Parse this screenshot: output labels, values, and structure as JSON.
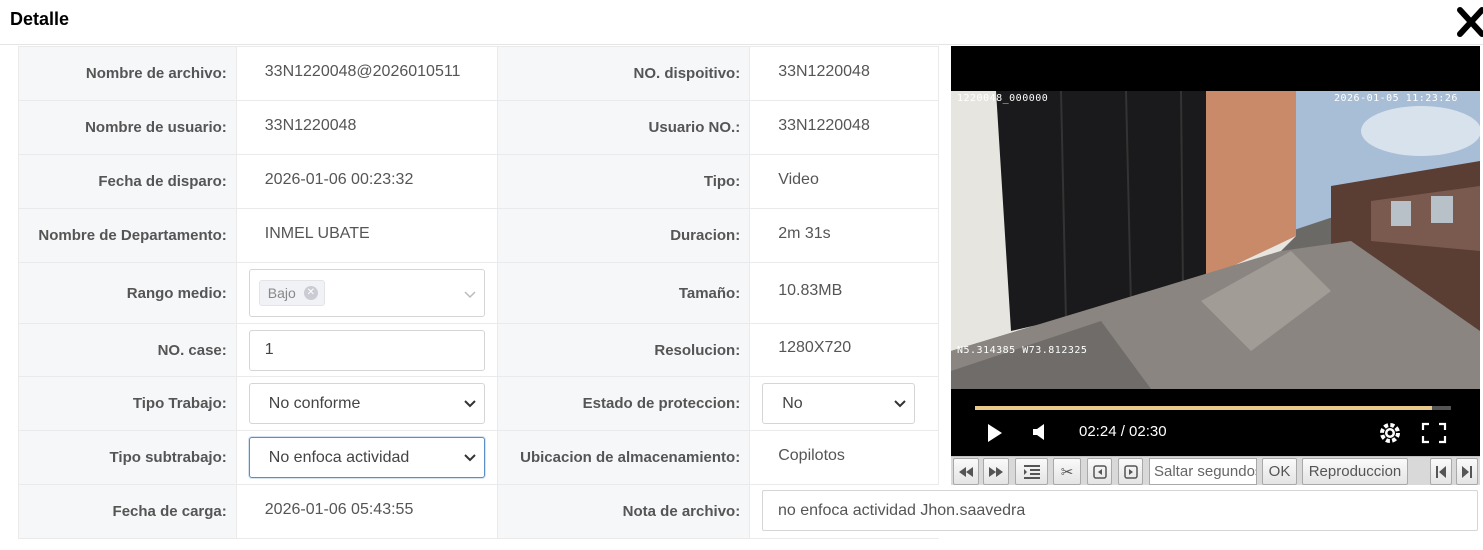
{
  "dialog": {
    "title": "Detalle",
    "close_icon": "close-icon"
  },
  "fields": {
    "filename_label": "Nombre de archivo:",
    "filename_value": "33N1220048@2026010511",
    "device_label": "NO. dispoitivo:",
    "device_value": "33N1220048",
    "user_label": "Nombre de usuario:",
    "user_value": "33N1220048",
    "userno_label": "Usuario NO.:",
    "userno_value": "33N1220048",
    "trigger_label": "Fecha de disparo:",
    "trigger_value": "2026-01-06 00:23:32",
    "type_label": "Tipo:",
    "type_value": "Video",
    "dept_label": "Nombre de Departamento:",
    "dept_value": "INMEL UBATE",
    "duration_label": "Duracion:",
    "duration_value": "2m 31s",
    "range_label": "Rango medio:",
    "range_tag": "Bajo",
    "size_label": "Tamaño:",
    "size_value": "10.83MB",
    "case_label": "NO. case:",
    "case_value": "1",
    "resolution_label": "Resolucion:",
    "resolution_value": "1280X720",
    "worktype_label": "Tipo Trabajo:",
    "worktype_value": "No conforme",
    "protection_label": "Estado de proteccion:",
    "protection_value": "No",
    "subwork_label": "Tipo subtrabajo:",
    "subwork_value": "No enfoca actividad",
    "storage_label": "Ubicacion de almacenamiento:",
    "storage_value": "Copilotos",
    "upload_label": "Fecha de carga:",
    "upload_value": "2026-01-06 05:43:55",
    "note_label": "Nota de archivo:",
    "note_value": "no enfoca actividad Jhon.saavedra"
  },
  "player": {
    "osd_id": "1220048_000000",
    "osd_datetime": "2026-01-05 11:23:26",
    "osd_gps": "N5.314385 W73.812325",
    "time_display": "02:24 / 02:30",
    "progress_fraction": 0.96,
    "colors": {
      "progress": "#e8c98a",
      "background": "#000000"
    }
  },
  "toolbar": {
    "seek_placeholder": "Saltar segundos",
    "ok_label": "OK",
    "playback_label": "Reproduccion"
  }
}
